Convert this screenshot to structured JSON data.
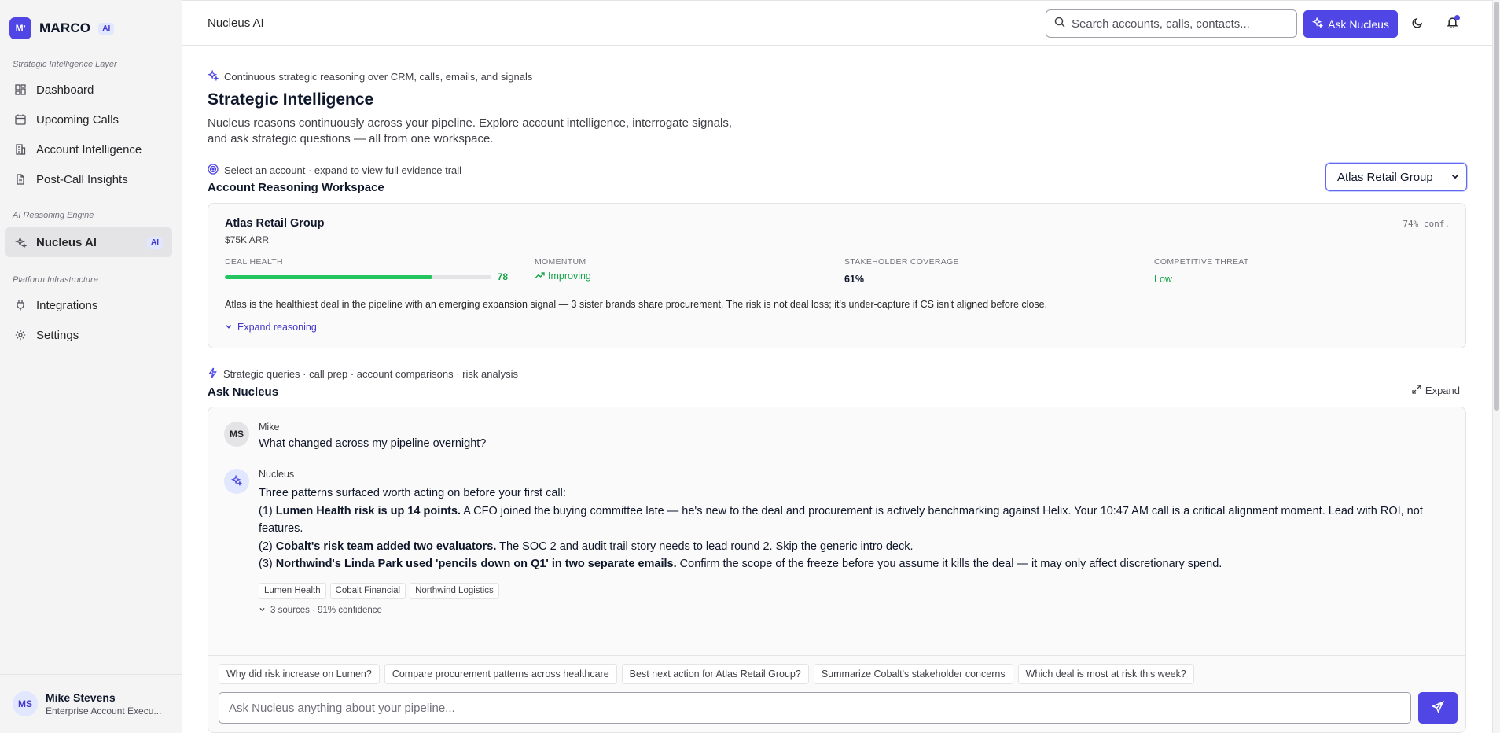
{
  "brand": {
    "logo": "M",
    "name": "MARCO",
    "badge": "AI"
  },
  "sidebar": {
    "sections": [
      {
        "label": "Strategic Intelligence Layer"
      },
      {
        "label": "AI Reasoning Engine"
      },
      {
        "label": "Platform Infrastructure"
      }
    ],
    "items": [
      {
        "label": "Dashboard",
        "icon": "dashboard-icon"
      },
      {
        "label": "Upcoming Calls",
        "icon": "calendar-icon"
      },
      {
        "label": "Account Intelligence",
        "icon": "building-icon"
      },
      {
        "label": "Post-Call Insights",
        "icon": "document-icon"
      },
      {
        "label": "Nucleus AI",
        "icon": "sparkle-icon",
        "badge": "AI",
        "active": true
      },
      {
        "label": "Integrations",
        "icon": "plug-icon"
      },
      {
        "label": "Settings",
        "icon": "gear-icon"
      }
    ],
    "user": {
      "initials": "MS",
      "name": "Mike Stevens",
      "role": "Enterprise Account Execu..."
    }
  },
  "topbar": {
    "title": "Nucleus AI",
    "search_placeholder": "Search accounts, calls, contacts...",
    "ask_label": "Ask Nucleus"
  },
  "header": {
    "eyebrow": "Continuous strategic reasoning over CRM, calls, emails, and signals",
    "title": "Strategic Intelligence",
    "description": "Nucleus reasons continuously across your pipeline. Explore account intelligence, interrogate signals, and ask strategic questions — all from one workspace."
  },
  "workspace": {
    "eyebrow": "Select an account · expand to view full evidence trail",
    "title": "Account Reasoning Workspace",
    "selected_account": "Atlas Retail Group",
    "card": {
      "name": "Atlas Retail Group",
      "arr": "$75K ARR",
      "confidence": "74% conf.",
      "deal_health_label": "DEAL HEALTH",
      "deal_health_value": "78",
      "deal_health_fraction": 0.78,
      "momentum_label": "MOMENTUM",
      "momentum_value": "Improving",
      "coverage_label": "STAKEHOLDER COVERAGE",
      "coverage_value": "61%",
      "threat_label": "COMPETITIVE THREAT",
      "threat_value": "Low",
      "summary": "Atlas is the healthiest deal in the pipeline with an emerging expansion signal — 3 sister brands share procurement. The risk is not deal loss; it's under-capture if CS isn't aligned before close.",
      "expand_label": "Expand reasoning"
    }
  },
  "ask": {
    "eyebrow": "Strategic queries · call prep · account comparisons · risk analysis",
    "title": "Ask Nucleus",
    "expand_label": "Expand",
    "messages": {
      "user": {
        "initials": "MS",
        "name": "Mike",
        "text": "What changed across my pipeline overnight?"
      },
      "assistant": {
        "name": "Nucleus",
        "intro": "Three patterns surfaced worth acting on before your first call:",
        "p1_prefix": "(1) ",
        "p1_bold": "Lumen Health risk is up 14 points.",
        "p1_rest": " A CFO joined the buying committee late — he's new to the deal and procurement is actively benchmarking against Helix. Your 10:47 AM call is a critical alignment moment. Lead with ROI, not features.",
        "p2_prefix": "(2) ",
        "p2_bold": "Cobalt's risk team added two evaluators.",
        "p2_rest": " The SOC 2 and audit trail story needs to lead round 2. Skip the generic intro deck.",
        "p3_prefix": "(3) ",
        "p3_bold": "Northwind's Linda Park used 'pencils down on Q1' in two separate emails.",
        "p3_rest": " Confirm the scope of the freeze before you assume it kills the deal — it may only affect discretionary spend.",
        "chips": [
          "Lumen Health",
          "Cobalt Financial",
          "Northwind Logistics"
        ],
        "sources": "3 sources · 91% confidence"
      }
    },
    "suggestions": [
      "Why did risk increase on Lumen?",
      "Compare procurement patterns across healthcare",
      "Best next action for Atlas Retail Group?",
      "Summarize Cobalt's stakeholder concerns",
      "Which deal is most at risk this week?"
    ],
    "input_placeholder": "Ask Nucleus anything about your pipeline..."
  },
  "colors": {
    "accent": "#4f46e5",
    "success": "#16a34a",
    "health_bar": "#22c55e"
  }
}
